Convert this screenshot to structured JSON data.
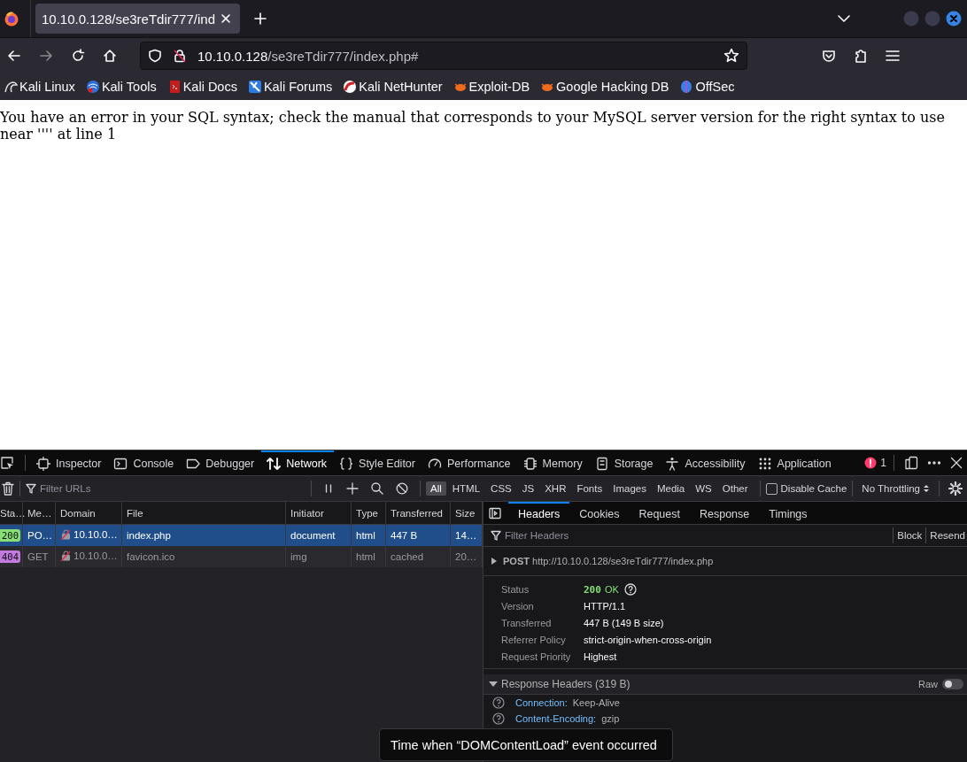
{
  "browser_tabs": [
    {
      "title": "10.10.0.128/se3reTdir777/ind",
      "selected": true
    }
  ],
  "address_bar": {
    "host": "10.10.0.128",
    "path": "/se3reTdir777/index.php#"
  },
  "bookmarks": [
    {
      "label": "Kali Linux"
    },
    {
      "label": "Kali Tools"
    },
    {
      "label": "Kali Docs"
    },
    {
      "label": "Kali Forums"
    },
    {
      "label": "Kali NetHunter"
    },
    {
      "label": "Exploit-DB"
    },
    {
      "label": "Google Hacking DB"
    },
    {
      "label": "OffSec"
    }
  ],
  "page": {
    "error_message": "You have an error in your SQL syntax; check the manual that corresponds to your MySQL server version for the right syntax to use near '''' at line 1"
  },
  "devtools": {
    "tools": [
      {
        "label": "Inspector",
        "selected": false
      },
      {
        "label": "Console",
        "selected": false
      },
      {
        "label": "Debugger",
        "selected": false
      },
      {
        "label": "Network",
        "selected": true
      },
      {
        "label": "Style Editor",
        "selected": false
      },
      {
        "label": "Performance",
        "selected": false
      },
      {
        "label": "Memory",
        "selected": false
      },
      {
        "label": "Storage",
        "selected": false
      },
      {
        "label": "Accessibility",
        "selected": false
      },
      {
        "label": "Application",
        "selected": false
      }
    ],
    "error_count": "1",
    "network_toolbar": {
      "filter_placeholder": "Filter URLs",
      "type_filters": [
        {
          "label": "All",
          "selected": true
        },
        {
          "label": "HTML",
          "selected": false
        },
        {
          "label": "CSS",
          "selected": false
        },
        {
          "label": "JS",
          "selected": false
        },
        {
          "label": "XHR",
          "selected": false
        },
        {
          "label": "Fonts",
          "selected": false
        },
        {
          "label": "Images",
          "selected": false
        },
        {
          "label": "Media",
          "selected": false
        },
        {
          "label": "WS",
          "selected": false
        },
        {
          "label": "Other",
          "selected": false
        }
      ],
      "disable_cache": {
        "label": "Disable Cache",
        "checked": false
      },
      "throttling": "No Throttling"
    },
    "table": {
      "columns": [
        "Sta…",
        "Me…",
        "Domain",
        "File",
        "Initiator",
        "Type",
        "Transferred",
        "Size"
      ],
      "rows": [
        {
          "status": "200",
          "color": "#86de74",
          "method": "PO…",
          "domain": "10.10.0…",
          "file": "index.php",
          "initiator": "document",
          "type": "html",
          "transferred": "447 B",
          "size": "14…",
          "selected": true,
          "cached": false
        },
        {
          "status": "404",
          "color": "#c27adf",
          "method": "GET",
          "domain": "10.10.0…",
          "file": "favicon.ico",
          "initiator": "img",
          "type": "html",
          "transferred": "cached",
          "size": "20…",
          "selected": false,
          "cached": true
        }
      ]
    },
    "details": {
      "tabs": [
        {
          "label": "Headers",
          "selected": true
        },
        {
          "label": "Cookies",
          "selected": false
        },
        {
          "label": "Request",
          "selected": false
        },
        {
          "label": "Response",
          "selected": false
        },
        {
          "label": "Timings",
          "selected": false
        }
      ],
      "filter_placeholder": "Filter Headers",
      "actions": [
        "Block",
        "Resend"
      ],
      "request": {
        "method": "POST",
        "url": "http://10.10.0.128/se3reTdir777/index.php",
        "expanded": false
      },
      "summary": [
        {
          "kind": "status",
          "label": "Status",
          "code": "200",
          "text": "OK"
        },
        {
          "kind": "text",
          "label": "Version",
          "value": "HTTP/1.1"
        },
        {
          "kind": "text",
          "label": "Transferred",
          "value": "447 B (149 B size)"
        },
        {
          "kind": "text",
          "label": "Referrer Policy",
          "value": "strict-origin-when-cross-origin"
        },
        {
          "kind": "text",
          "label": "Request Priority",
          "value": "Highest"
        }
      ],
      "response_headers": {
        "title": "Response Headers (319 B)",
        "expanded": true,
        "raw": {
          "label": "Raw",
          "on": false
        },
        "headers": [
          {
            "name": "Connection:",
            "value": "Keep-Alive"
          },
          {
            "name": "Content-Encoding:",
            "value": "gzip"
          }
        ]
      }
    },
    "tooltip": "Time when “DOMContentLoad” event occurred"
  }
}
